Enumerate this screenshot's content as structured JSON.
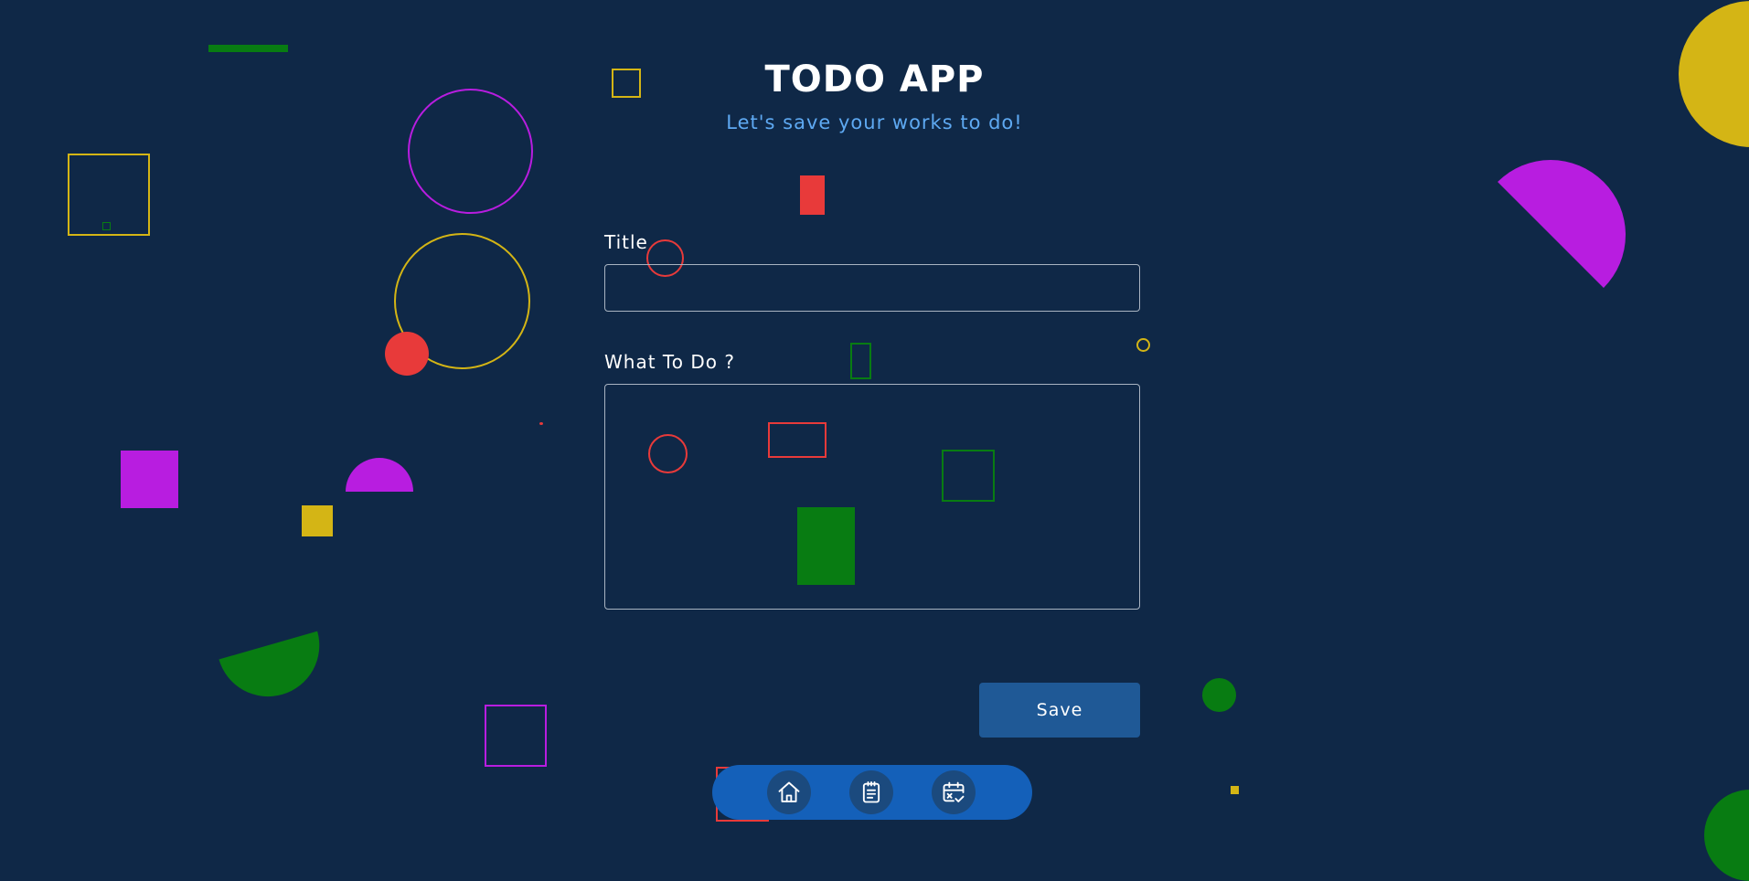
{
  "header": {
    "title": "TODO APP",
    "subtitle": "Let's save your works to do!"
  },
  "form": {
    "title_label": "Title",
    "title_value": "",
    "todo_label": "What To Do ?",
    "todo_value": "",
    "save_label": "Save"
  },
  "nav": {
    "items": [
      {
        "icon": "home-icon"
      },
      {
        "icon": "notepad-icon"
      },
      {
        "icon": "calendar-check-icon"
      }
    ]
  },
  "colors": {
    "background": "#0f2847",
    "accent_blue": "#1460b9",
    "save_button": "#1f5996",
    "subtitle": "#5ea9f2",
    "yellow": "#d4b515",
    "purple": "#b81de0",
    "red": "#e83a3a",
    "green": "#087c12"
  }
}
